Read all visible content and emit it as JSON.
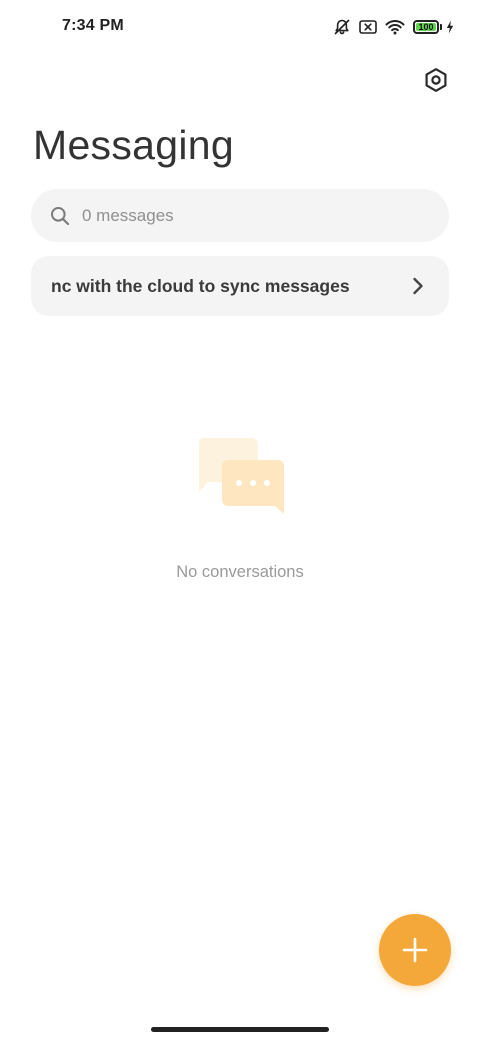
{
  "status_bar": {
    "time": "7:34 PM",
    "battery_level": "100",
    "icons": [
      "bell-off-icon",
      "sim-off-icon",
      "wifi-icon",
      "battery-icon",
      "charging-icon"
    ]
  },
  "header": {
    "title": "Messaging",
    "settings_icon": "settings-hexagon-icon"
  },
  "search": {
    "placeholder": "0 messages",
    "value": "",
    "icon": "search-icon"
  },
  "sync_banner": {
    "text": "Sync with the cloud to sync messages",
    "visible_text": "nc with the cloud to sync messages",
    "icon": "chevron-right-icon"
  },
  "empty_state": {
    "illustration": "chat-bubbles-icon",
    "text": "No conversations"
  },
  "fab": {
    "icon": "plus-icon"
  },
  "colors": {
    "accent": "#f5a83a",
    "illustration_light": "#fdf0d8",
    "illustration_dark": "#fde7c2",
    "battery_fill": "#5ed44e",
    "surface": "#f4f4f4",
    "title": "#333333",
    "muted_text": "#9a9a9a"
  }
}
